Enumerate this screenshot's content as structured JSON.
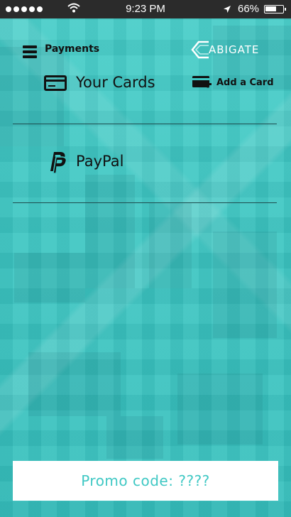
{
  "status_bar": {
    "time": "9:23 PM",
    "battery_percent": "66%",
    "battery_level": 0.66,
    "signal_dots": 5
  },
  "header": {
    "title": "Payments",
    "logo_text": "ABIGATE",
    "menu_icon": "hamburger-menu-icon"
  },
  "cards": {
    "label": "Your Cards",
    "add_card_label": "Add a Card",
    "icon": "credit-card-icon",
    "add_icon": "add-card-icon"
  },
  "paypal": {
    "label": "PayPal",
    "icon": "paypal-icon"
  },
  "promo": {
    "label": "Promo code: ????"
  },
  "colors": {
    "accent": "#3fc8c4",
    "status_bar": "#2b2b2b",
    "text": "#111111",
    "divider": "#1e4d4f"
  }
}
